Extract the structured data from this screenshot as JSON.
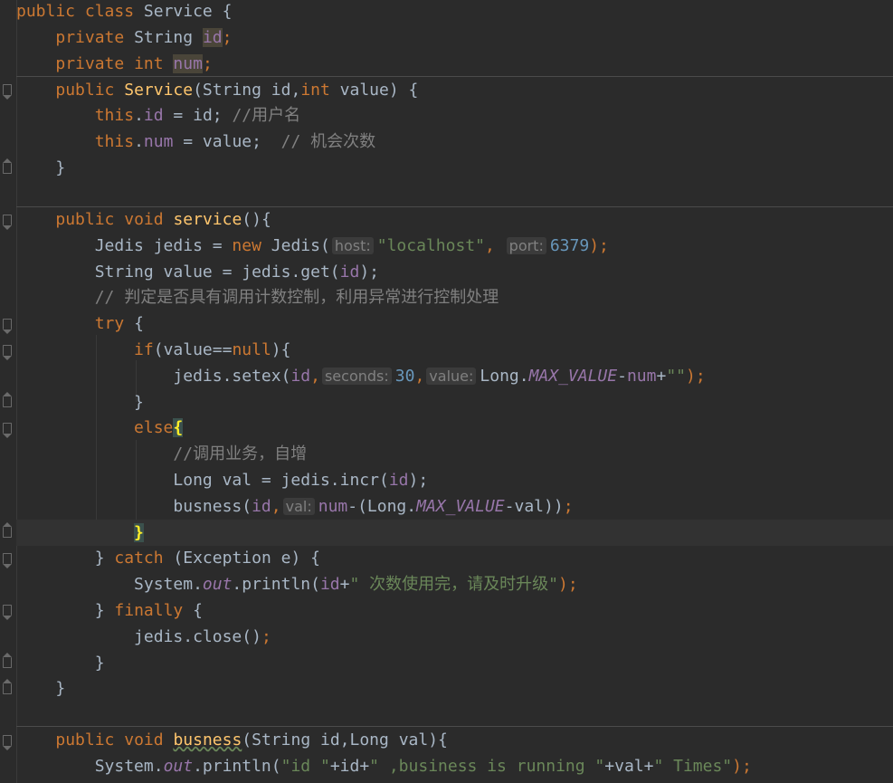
{
  "editor": {
    "lines": {
      "l1": [
        "public class",
        "Service {"
      ],
      "l2": [
        "private",
        "String",
        "id",
        ";"
      ],
      "l3": [
        "private",
        "int",
        "num",
        ";"
      ],
      "l4": [
        "public",
        "Service",
        "(String id,",
        "int",
        "value) {"
      ],
      "l5": [
        "this",
        ".",
        "id",
        " = id; ",
        "//用户名"
      ],
      "l6": [
        "this",
        ".",
        "num",
        " = value;  ",
        "// 机会次数"
      ],
      "l7": [
        "}"
      ],
      "l8": [
        "public",
        "void",
        "service",
        "(){"
      ],
      "l9": [
        "Jedis jedis = ",
        "new",
        "Jedis(",
        "host:",
        "\"localhost\"",
        ",",
        "port:",
        "6379",
        ");"
      ],
      "l10": [
        "String value = jedis.get(",
        "id",
        ");"
      ],
      "l11": [
        "// 判定是否具有调用计数控制，利用异常进行控制处理"
      ],
      "l12": [
        "try",
        "{"
      ],
      "l13": [
        "if",
        "(value==",
        "null",
        "){"
      ],
      "l14": [
        "jedis.setex(",
        "id",
        ",",
        "seconds:",
        "30",
        ",",
        "value:",
        "Long.",
        "MAX_VALUE",
        "-",
        "num",
        "+",
        "\"\"",
        ");"
      ],
      "l15": [
        "}"
      ],
      "l16": [
        "else",
        "{"
      ],
      "l17": [
        "//调用业务，自增"
      ],
      "l18": [
        "Long val = jedis.incr(",
        "id",
        ");"
      ],
      "l19": [
        "busness(",
        "id",
        ",",
        "val:",
        "num",
        "-(Long.",
        "MAX_VALUE",
        "-val))",
        ";"
      ],
      "l20": [
        "}"
      ],
      "l21": [
        "} ",
        "catch",
        "(Exception e) {"
      ],
      "l22": [
        "System.",
        "out",
        ".println(",
        "id",
        "+",
        "\" 次数使用完，请及时升级\"",
        ");"
      ],
      "l23": [
        "} ",
        "finally",
        "{"
      ],
      "l24": [
        "jedis.close()",
        ";"
      ],
      "l25": [
        "}"
      ],
      "l26": [
        "}"
      ],
      "l27": [
        "public",
        "void",
        "busness",
        "(String id,Long val){"
      ],
      "l28": [
        "System.",
        "out",
        ".println(",
        "\"id \"",
        "+id+",
        "\" ,business is running \"",
        "+val+",
        "\" Times\"",
        ");"
      ]
    }
  }
}
